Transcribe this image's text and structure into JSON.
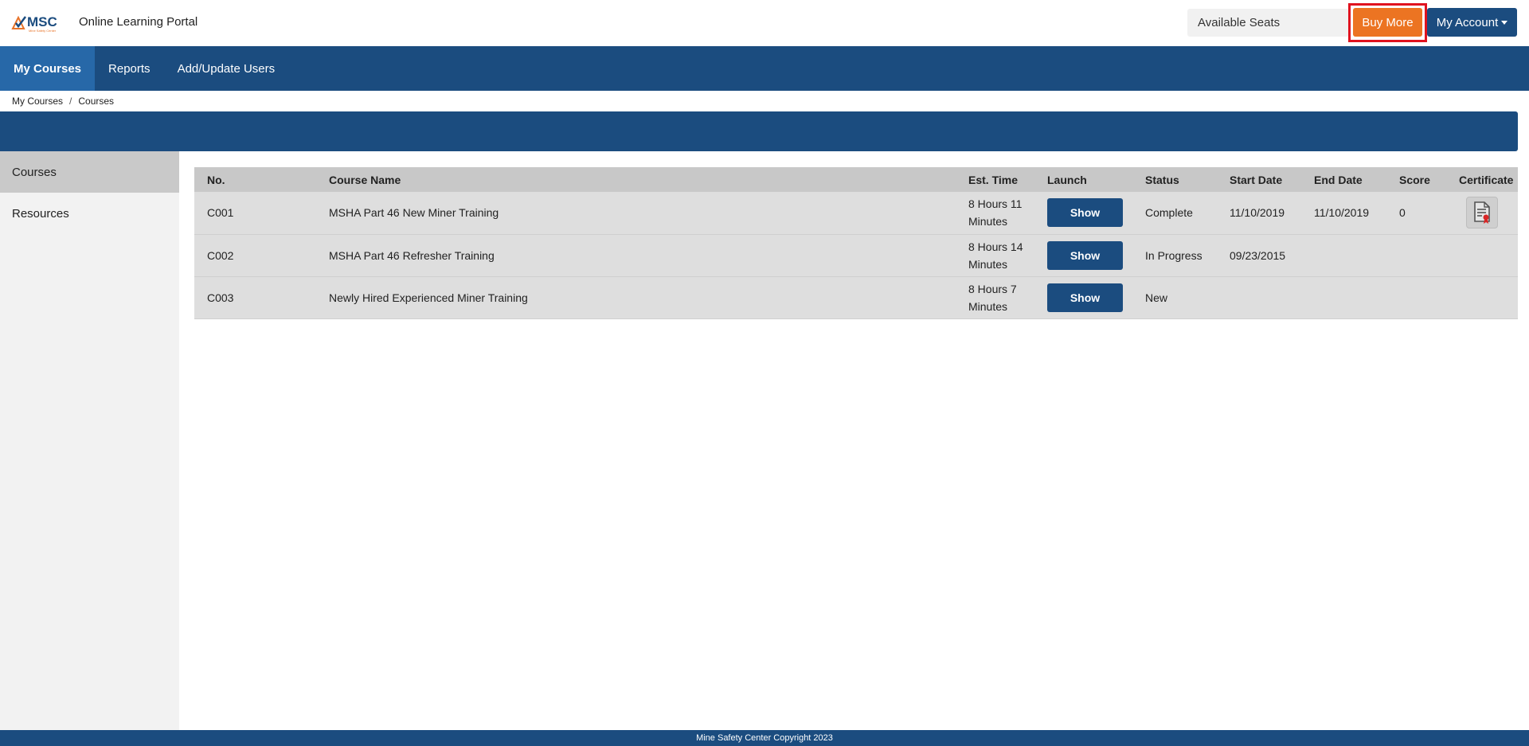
{
  "header": {
    "logo_text": "MSC",
    "logo_subtext": "Mine Safety Center",
    "portal_title": "Online Learning Portal",
    "available_seats_label": "Available Seats",
    "buy_more_label": "Buy More",
    "my_account_label": "My Account"
  },
  "nav": {
    "items": [
      {
        "label": "My Courses"
      },
      {
        "label": "Reports"
      },
      {
        "label": "Add/Update Users"
      }
    ]
  },
  "breadcrumb": {
    "items": [
      "My Courses",
      "Courses"
    ],
    "separator": "/"
  },
  "sidebar": {
    "items": [
      {
        "label": "Courses"
      },
      {
        "label": "Resources"
      }
    ]
  },
  "table": {
    "headers": {
      "no": "No.",
      "name": "Course Name",
      "time": "Est. Time",
      "launch": "Launch",
      "status": "Status",
      "start": "Start Date",
      "end": "End Date",
      "score": "Score",
      "certificate": "Certificate"
    },
    "rows": [
      {
        "no": "C001",
        "name": "MSHA Part 46 New Miner Training",
        "time_line1": "8 Hours 11",
        "time_line2": "Minutes",
        "launch": "Show",
        "status": "Complete",
        "start": "11/10/2019",
        "end": "11/10/2019",
        "score": "0",
        "certificate_icon": "certificate-icon"
      },
      {
        "no": "C002",
        "name": "MSHA Part 46 Refresher Training",
        "time_line1": "8 Hours 14",
        "time_line2": "Minutes",
        "launch": "Show",
        "status": "In Progress",
        "start": "09/23/2015",
        "end": "",
        "score": "",
        "certificate_icon": ""
      },
      {
        "no": "C003",
        "name": "Newly Hired Experienced Miner Training",
        "time_line1": "8 Hours 7",
        "time_line2": "Minutes",
        "launch": "Show",
        "status": "New",
        "start": "",
        "end": "",
        "score": "",
        "certificate_icon": ""
      }
    ]
  },
  "footer": {
    "text": "Mine Safety Center Copyright 2023"
  },
  "colors": {
    "primary": "#1b4c7f",
    "nav_active": "#2768a8",
    "buy_more": "#ec7422",
    "highlight": "#e0131f"
  }
}
